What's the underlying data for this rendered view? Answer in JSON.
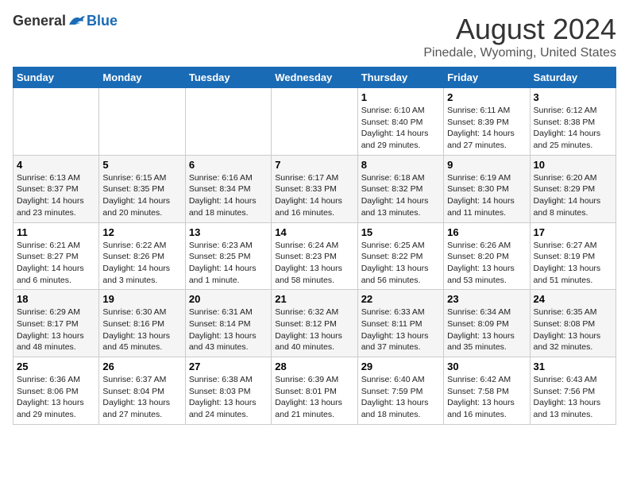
{
  "logo": {
    "general": "General",
    "blue": "Blue"
  },
  "title": "August 2024",
  "subtitle": "Pinedale, Wyoming, United States",
  "weekdays": [
    "Sunday",
    "Monday",
    "Tuesday",
    "Wednesday",
    "Thursday",
    "Friday",
    "Saturday"
  ],
  "weeks": [
    [
      {
        "day": "",
        "info": ""
      },
      {
        "day": "",
        "info": ""
      },
      {
        "day": "",
        "info": ""
      },
      {
        "day": "",
        "info": ""
      },
      {
        "day": "1",
        "info": "Sunrise: 6:10 AM\nSunset: 8:40 PM\nDaylight: 14 hours\nand 29 minutes."
      },
      {
        "day": "2",
        "info": "Sunrise: 6:11 AM\nSunset: 8:39 PM\nDaylight: 14 hours\nand 27 minutes."
      },
      {
        "day": "3",
        "info": "Sunrise: 6:12 AM\nSunset: 8:38 PM\nDaylight: 14 hours\nand 25 minutes."
      }
    ],
    [
      {
        "day": "4",
        "info": "Sunrise: 6:13 AM\nSunset: 8:37 PM\nDaylight: 14 hours\nand 23 minutes."
      },
      {
        "day": "5",
        "info": "Sunrise: 6:15 AM\nSunset: 8:35 PM\nDaylight: 14 hours\nand 20 minutes."
      },
      {
        "day": "6",
        "info": "Sunrise: 6:16 AM\nSunset: 8:34 PM\nDaylight: 14 hours\nand 18 minutes."
      },
      {
        "day": "7",
        "info": "Sunrise: 6:17 AM\nSunset: 8:33 PM\nDaylight: 14 hours\nand 16 minutes."
      },
      {
        "day": "8",
        "info": "Sunrise: 6:18 AM\nSunset: 8:32 PM\nDaylight: 14 hours\nand 13 minutes."
      },
      {
        "day": "9",
        "info": "Sunrise: 6:19 AM\nSunset: 8:30 PM\nDaylight: 14 hours\nand 11 minutes."
      },
      {
        "day": "10",
        "info": "Sunrise: 6:20 AM\nSunset: 8:29 PM\nDaylight: 14 hours\nand 8 minutes."
      }
    ],
    [
      {
        "day": "11",
        "info": "Sunrise: 6:21 AM\nSunset: 8:27 PM\nDaylight: 14 hours\nand 6 minutes."
      },
      {
        "day": "12",
        "info": "Sunrise: 6:22 AM\nSunset: 8:26 PM\nDaylight: 14 hours\nand 3 minutes."
      },
      {
        "day": "13",
        "info": "Sunrise: 6:23 AM\nSunset: 8:25 PM\nDaylight: 14 hours\nand 1 minute."
      },
      {
        "day": "14",
        "info": "Sunrise: 6:24 AM\nSunset: 8:23 PM\nDaylight: 13 hours\nand 58 minutes."
      },
      {
        "day": "15",
        "info": "Sunrise: 6:25 AM\nSunset: 8:22 PM\nDaylight: 13 hours\nand 56 minutes."
      },
      {
        "day": "16",
        "info": "Sunrise: 6:26 AM\nSunset: 8:20 PM\nDaylight: 13 hours\nand 53 minutes."
      },
      {
        "day": "17",
        "info": "Sunrise: 6:27 AM\nSunset: 8:19 PM\nDaylight: 13 hours\nand 51 minutes."
      }
    ],
    [
      {
        "day": "18",
        "info": "Sunrise: 6:29 AM\nSunset: 8:17 PM\nDaylight: 13 hours\nand 48 minutes."
      },
      {
        "day": "19",
        "info": "Sunrise: 6:30 AM\nSunset: 8:16 PM\nDaylight: 13 hours\nand 45 minutes."
      },
      {
        "day": "20",
        "info": "Sunrise: 6:31 AM\nSunset: 8:14 PM\nDaylight: 13 hours\nand 43 minutes."
      },
      {
        "day": "21",
        "info": "Sunrise: 6:32 AM\nSunset: 8:12 PM\nDaylight: 13 hours\nand 40 minutes."
      },
      {
        "day": "22",
        "info": "Sunrise: 6:33 AM\nSunset: 8:11 PM\nDaylight: 13 hours\nand 37 minutes."
      },
      {
        "day": "23",
        "info": "Sunrise: 6:34 AM\nSunset: 8:09 PM\nDaylight: 13 hours\nand 35 minutes."
      },
      {
        "day": "24",
        "info": "Sunrise: 6:35 AM\nSunset: 8:08 PM\nDaylight: 13 hours\nand 32 minutes."
      }
    ],
    [
      {
        "day": "25",
        "info": "Sunrise: 6:36 AM\nSunset: 8:06 PM\nDaylight: 13 hours\nand 29 minutes."
      },
      {
        "day": "26",
        "info": "Sunrise: 6:37 AM\nSunset: 8:04 PM\nDaylight: 13 hours\nand 27 minutes."
      },
      {
        "day": "27",
        "info": "Sunrise: 6:38 AM\nSunset: 8:03 PM\nDaylight: 13 hours\nand 24 minutes."
      },
      {
        "day": "28",
        "info": "Sunrise: 6:39 AM\nSunset: 8:01 PM\nDaylight: 13 hours\nand 21 minutes."
      },
      {
        "day": "29",
        "info": "Sunrise: 6:40 AM\nSunset: 7:59 PM\nDaylight: 13 hours\nand 18 minutes."
      },
      {
        "day": "30",
        "info": "Sunrise: 6:42 AM\nSunset: 7:58 PM\nDaylight: 13 hours\nand 16 minutes."
      },
      {
        "day": "31",
        "info": "Sunrise: 6:43 AM\nSunset: 7:56 PM\nDaylight: 13 hours\nand 13 minutes."
      }
    ]
  ]
}
